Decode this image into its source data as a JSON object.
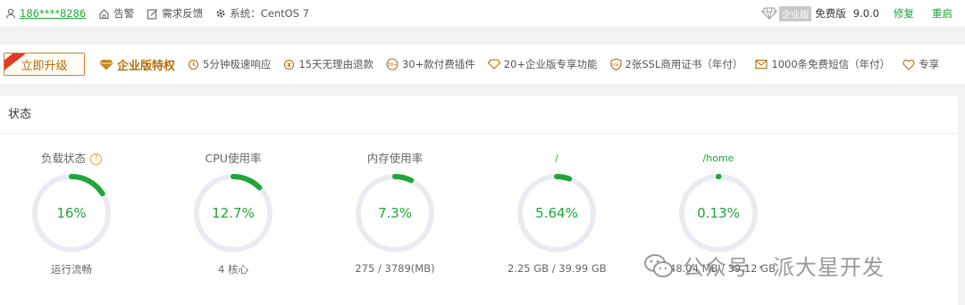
{
  "topbar": {
    "user": "186****8286",
    "alarm": "告警",
    "feedback": "需求反馈",
    "system": "系统：CentOS 7",
    "edition_badge": "企业版",
    "edition": "免费版",
    "version": "9.0.0",
    "repair": "修复",
    "restart": "重启"
  },
  "promo": {
    "upgrade": "立即升级",
    "enterprise_feature": "企业版特权",
    "features": [
      {
        "icon": "fast-response-icon",
        "label": "5分钟极速响应"
      },
      {
        "icon": "refund-icon",
        "label": "15天无理由退款"
      },
      {
        "icon": "plugin-icon",
        "label": "30+款付费插件"
      },
      {
        "icon": "diamond-icon",
        "label": "20+企业版专享功能"
      },
      {
        "icon": "ssl-icon",
        "label": "2张SSL商用证书（年付）"
      },
      {
        "icon": "sms-icon",
        "label": "1000条免费短信（年付）"
      },
      {
        "icon": "exclusive-icon",
        "label": "专享"
      }
    ]
  },
  "status": {
    "title": "状态",
    "gauges": [
      {
        "title": "负载状态",
        "percent": 16,
        "value": "16%",
        "sub": "运行流畅",
        "help": "?"
      },
      {
        "title": "CPU使用率",
        "percent": 12.7,
        "value": "12.7%",
        "sub": "4 核心"
      },
      {
        "title": "内存使用率",
        "percent": 7.3,
        "value": "7.3%",
        "sub": "275 / 3789(MB)"
      },
      {
        "title": "/",
        "percent": 5.64,
        "value": "5.64%",
        "sub": "2.25 GB / 39.99 GB"
      },
      {
        "title": "/home",
        "percent": 0.13,
        "value": "0.13%",
        "sub": "48.04 MB / 39.12 GB"
      }
    ]
  },
  "watermark": "公众号 · 派大星开发",
  "colors": {
    "accent": "#20a53a",
    "gold": "#b2700e",
    "track": "#e8ecf2"
  }
}
